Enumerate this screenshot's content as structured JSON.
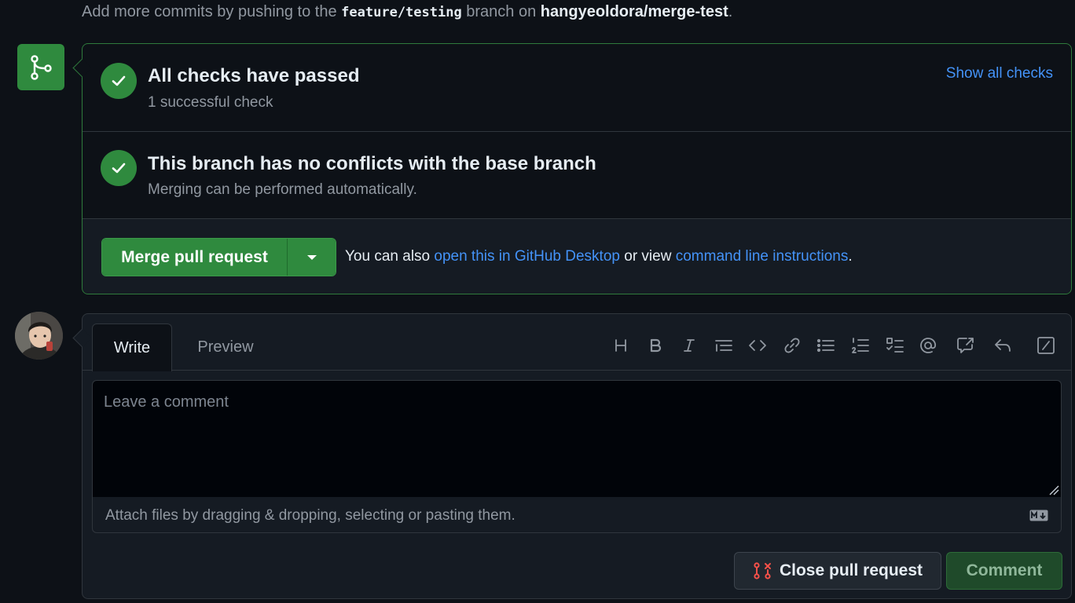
{
  "top_line": {
    "prefix": "Add more commits by pushing to the",
    "branch": "feature/testing",
    "middle": "branch on",
    "repo": "hangyeoldora/merge-test",
    "suffix": "."
  },
  "checks": {
    "title": "All checks have passed",
    "subtitle": "1 successful check",
    "show_all_label": "Show all checks"
  },
  "conflicts": {
    "title": "This branch has no conflicts with the base branch",
    "subtitle": "Merging can be performed automatically."
  },
  "merge": {
    "button_label": "Merge pull request",
    "also_prefix": "You can also",
    "desktop_link": "open this in GitHub Desktop",
    "or_view": "or view",
    "cli_link": "command line instructions",
    "suffix": "."
  },
  "comment": {
    "tabs": [
      "Write",
      "Preview"
    ],
    "toolbar_icons": [
      "heading-icon",
      "bold-icon",
      "italic-icon",
      "quote-icon",
      "code-icon",
      "link-icon",
      "unordered-list-icon",
      "ordered-list-icon",
      "task-list-icon",
      "mention-icon",
      "reference-icon",
      "reply-icon",
      "slash-command-icon"
    ],
    "placeholder": "Leave a comment",
    "attach_text": "Attach files by dragging & dropping, selecting or pasting them.",
    "close_label": "Close pull request",
    "comment_label": "Comment"
  },
  "colors": {
    "success": "#2f8a3e",
    "link": "#4493f8",
    "danger": "#f85149"
  }
}
